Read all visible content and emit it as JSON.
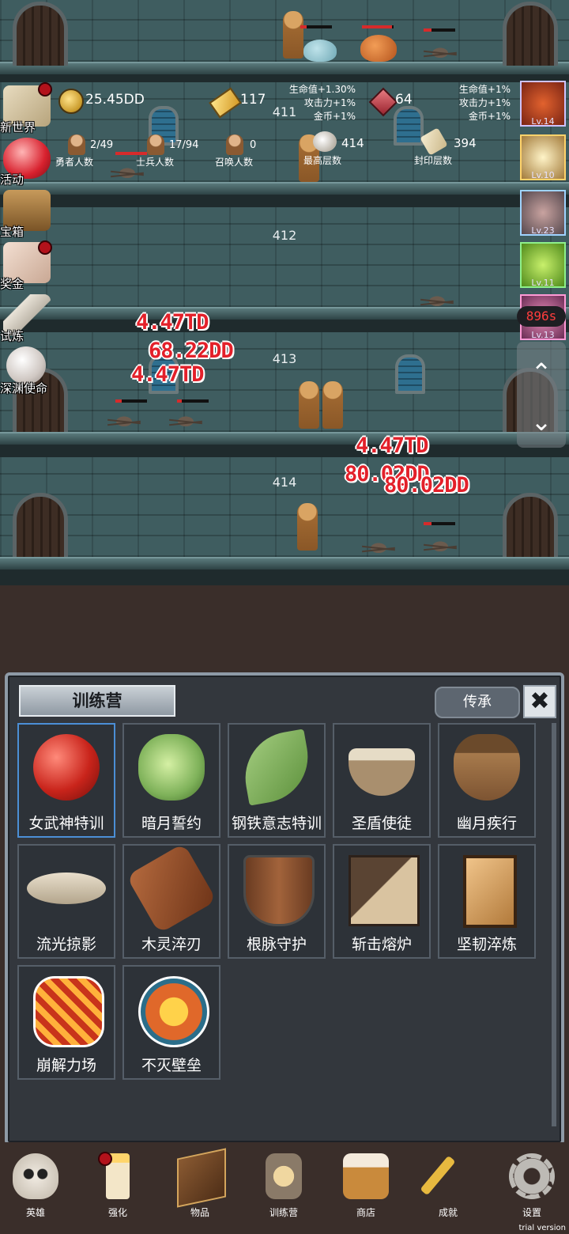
{
  "stats": {
    "coins": "25.45DD",
    "gold": "117",
    "gems": "64",
    "buff_left": [
      "生命值+1.30%",
      "攻击力+1%",
      "金币+1%"
    ],
    "buff_right": [
      "生命值+1%",
      "攻击力+1%",
      "金币+1%"
    ],
    "hero_count": "2/49",
    "hero_label": "勇者人数",
    "soldier_count": "17/94",
    "soldier_label": "士兵人数",
    "summon_count": "0",
    "summon_label": "召唤人数",
    "highest_floor": "414",
    "highest_label": "最高层数",
    "sealed_floor": "394",
    "sealed_label": "封印层数"
  },
  "floors": [
    "411",
    "412",
    "413",
    "414"
  ],
  "damage_numbers": [
    "4.47TD",
    "68.22DD",
    "4.47TD",
    "4.47TD",
    "80.02DD",
    "80.02DD"
  ],
  "side_menu": [
    {
      "label": "新世界",
      "icon": "map-icon"
    },
    {
      "label": "活动",
      "icon": "heart-icon"
    },
    {
      "label": "宝箱",
      "icon": "chest-icon"
    },
    {
      "label": "奖金",
      "icon": "letter-icon"
    },
    {
      "label": "试炼",
      "icon": "feather-icon"
    },
    {
      "label": "深渊使命",
      "icon": "pearl-icon"
    }
  ],
  "buffs": [
    {
      "level": "Lv.14",
      "icon": "apple-buff-icon"
    },
    {
      "level": "Lv.10",
      "icon": "candle-buff-icon"
    },
    {
      "level": "Lv.23",
      "icon": "box-buff-icon"
    },
    {
      "level": "Lv.11",
      "icon": "slime-buff-icon"
    },
    {
      "level": "Lv.13",
      "icon": "face-buff-icon"
    }
  ],
  "timer": "896s",
  "scroll_up": "⌃",
  "scroll_down": "⌄",
  "panel": {
    "title": "训练营",
    "legacy_button": "传承",
    "close_button": "✖",
    "items": [
      {
        "label": "女武神特训",
        "icon": "apple-icon"
      },
      {
        "label": "暗月誓约",
        "icon": "cabbage-icon"
      },
      {
        "label": "钢铁意志特训",
        "icon": "leaf-icon"
      },
      {
        "label": "圣盾使徒",
        "icon": "bowl-icon"
      },
      {
        "label": "幽月疾行",
        "icon": "acorn-icon"
      },
      {
        "label": "流光掠影",
        "icon": "fish-bone-icon"
      },
      {
        "label": "木灵淬刃",
        "icon": "log-icon"
      },
      {
        "label": "根脉守护",
        "icon": "wood-shield-icon"
      },
      {
        "label": "斩击熔炉",
        "icon": "block-icon"
      },
      {
        "label": "坚韧淬炼",
        "icon": "tower-shield-icon"
      },
      {
        "label": "崩解力场",
        "icon": "lava-tile-icon"
      },
      {
        "label": "不灭壁垒",
        "icon": "sun-disc-icon"
      }
    ]
  },
  "bottom_nav": [
    {
      "label": "英雄",
      "icon": "skull-icon"
    },
    {
      "label": "强化",
      "icon": "candle-icon"
    },
    {
      "label": "物品",
      "icon": "book-icon"
    },
    {
      "label": "训练营",
      "icon": "lantern-icon"
    },
    {
      "label": "商店",
      "icon": "beer-mug-icon"
    },
    {
      "label": "成就",
      "icon": "key-icon"
    },
    {
      "label": "设置",
      "icon": "gear-icon"
    }
  ],
  "trial_text": "trial version"
}
